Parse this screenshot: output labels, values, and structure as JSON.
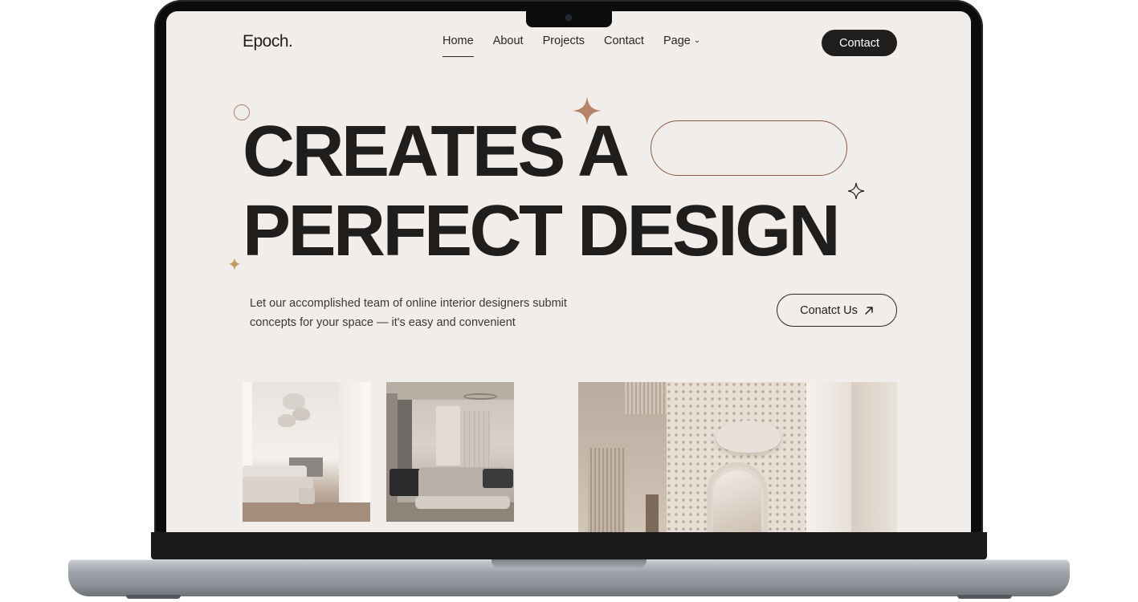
{
  "site": {
    "logo": "Epoch.",
    "nav": [
      {
        "label": "Home",
        "active": true
      },
      {
        "label": "About"
      },
      {
        "label": "Projects"
      },
      {
        "label": "Contact"
      },
      {
        "label": "Page",
        "has_dropdown": true
      }
    ],
    "header_cta": "Contact"
  },
  "hero": {
    "headline_line1": "CREATES A",
    "headline_line2": "PERFECT DESIGN",
    "description_line1": "Let our accomplished team of online interior designers submit",
    "description_line2": "concepts for your space — it's easy and convenient",
    "cta_label": "Conatct Us",
    "cta_icon": "arrow-up-right-icon"
  },
  "gallery": {
    "images": [
      {
        "subject": "living-room"
      },
      {
        "subject": "bedroom"
      },
      {
        "subject": "staircase-atrium"
      }
    ]
  },
  "colors": {
    "background": "#f1edea",
    "text": "#1f1e1d",
    "accent": "#b7826a",
    "pill_border": "#8a5a45"
  },
  "icons": {
    "star_accent": "four-point-star-icon",
    "star_outline": "four-point-star-outline-icon",
    "small_star": "small-star-icon",
    "circle": "circle-outline-icon"
  }
}
